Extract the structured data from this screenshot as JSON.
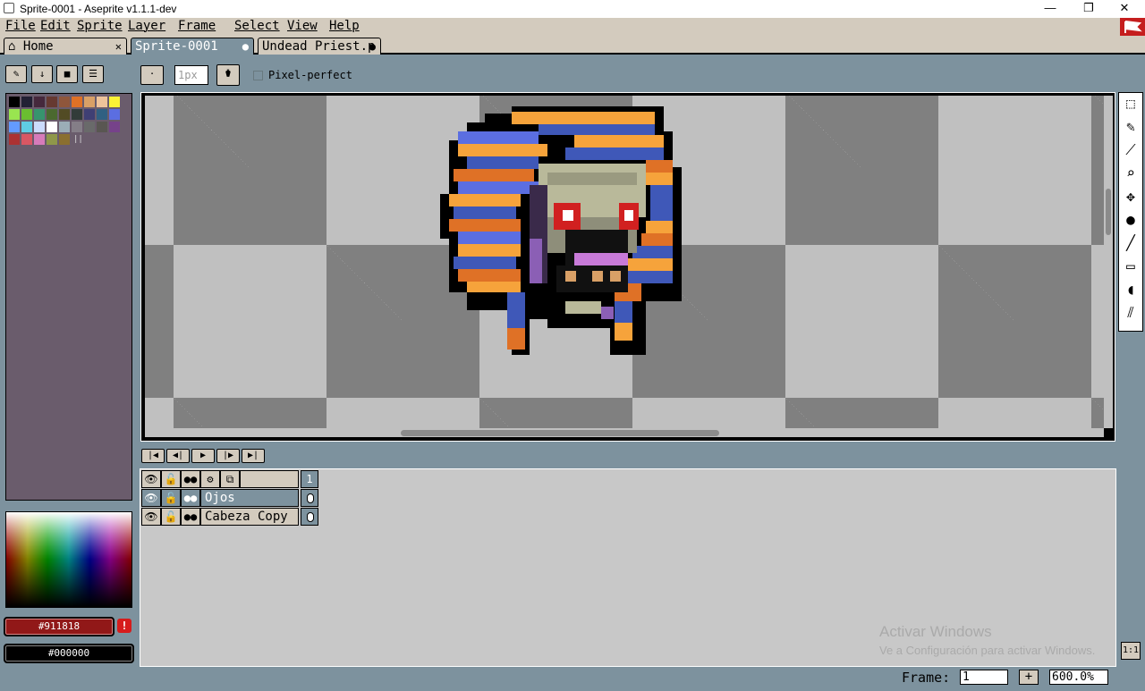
{
  "window": {
    "title": "Sprite-0001 - Aseprite v1.1.1-dev",
    "minimize": "—",
    "maximize": "❐",
    "close": "✕"
  },
  "menu": [
    "File",
    "Edit",
    "Sprite",
    "Layer",
    "Frame",
    "Select",
    "View",
    "Help"
  ],
  "tabs": [
    {
      "label": "Home",
      "icon": "home-icon",
      "close": "✕"
    },
    {
      "label": "Sprite-0001",
      "status": "●"
    },
    {
      "label": "Undead Priest.p",
      "status": "●"
    }
  ],
  "context_bar": {
    "brush_size": "1px",
    "pixel_perfect_label": "Pixel-perfect",
    "pixel_perfect_checked": false
  },
  "palette": {
    "colors": [
      "#000000",
      "#222034",
      "#45283c",
      "#663931",
      "#8f563b",
      "#df7126",
      "#d9a066",
      "#eec39a",
      "#fbf236",
      "#99e550",
      "#6abe30",
      "#37946e",
      "#4b692f",
      "#524b24",
      "#323c39",
      "#3f3f74",
      "#306082",
      "#5b6ee1",
      "#639bff",
      "#5fcde4",
      "#cbdbfc",
      "#ffffff",
      "#9badb7",
      "#847e87",
      "#696a6a",
      "#595652",
      "#76428a",
      "#ac3232",
      "#d95763",
      "#d77bba",
      "#8f974a",
      "#8a6f30"
    ]
  },
  "colors": {
    "foreground": "#911818",
    "background": "#000000",
    "warning": "!"
  },
  "playback": [
    "first-frame-icon",
    "prev-frame-icon",
    "play-icon",
    "next-frame-icon",
    "last-frame-icon"
  ],
  "timeline": {
    "frame_number": "1",
    "layers": [
      {
        "name": "Ojos"
      },
      {
        "name": "Cabeza Copy"
      }
    ]
  },
  "watermark": {
    "line1": "Activar Windows",
    "line2": "Ve a Configuración para activar Windows."
  },
  "status": {
    "frame_label": "Frame:",
    "frame_value": "1",
    "zoom": "600.0%",
    "zoom_reset": "1:1",
    "plus": "+"
  }
}
